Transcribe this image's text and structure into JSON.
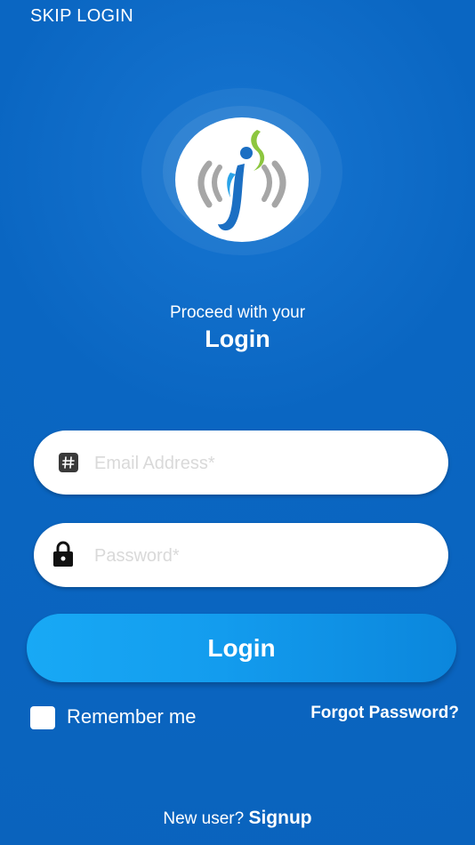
{
  "header": {
    "skip_label": "SKIP LOGIN"
  },
  "logo": {
    "icon": "app-logo-icon"
  },
  "intro": {
    "subtitle": "Proceed with your",
    "title": "Login"
  },
  "form": {
    "email": {
      "icon": "hash-icon",
      "placeholder": "Email Address*",
      "value": ""
    },
    "password": {
      "icon": "lock-icon",
      "placeholder": "Password*",
      "value": ""
    },
    "login_label": "Login",
    "remember_label": "Remember me",
    "remember_checked": false,
    "forgot_label": "Forgot Password?"
  },
  "footer": {
    "prompt": "New user?",
    "signup_label": "Signup"
  },
  "colors": {
    "background": "#0a66c2",
    "button": "#139cee",
    "logo_blue": "#1b6fc3",
    "logo_green": "#8cc63f",
    "logo_grey": "#a6a6a6"
  }
}
